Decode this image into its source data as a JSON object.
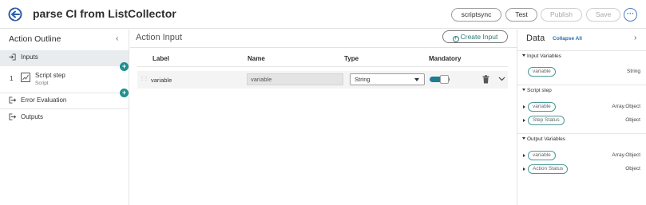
{
  "header": {
    "title": "parse CI from ListCollector",
    "buttons": {
      "scriptsync": "scriptsync",
      "test": "Test",
      "publish": "Publish",
      "save": "Save"
    },
    "more": "···"
  },
  "outline": {
    "title": "Action Outline",
    "collapse_glyph": "‹",
    "inputs": "Inputs",
    "step_number": "1",
    "script_step_title": "Script step",
    "script_step_sub": "Script",
    "error_evaluation": "Error Evaluation",
    "outputs": "Outputs",
    "add_glyph": "+"
  },
  "action_input": {
    "title": "Action Input",
    "create_button": "Create Input",
    "columns": {
      "label": "Label",
      "name": "Name",
      "type": "Type",
      "mandatory": "Mandatory"
    },
    "rows": [
      {
        "label": "variable",
        "name": "variable",
        "type": "String",
        "mandatory": true
      }
    ]
  },
  "data_panel": {
    "title": "Data",
    "collapse_all": "Collapse All",
    "expand_glyph": "›",
    "sections": [
      {
        "title": "Input Variables",
        "items": [
          {
            "pill": "variable",
            "type": "String"
          }
        ]
      },
      {
        "title": "Script step",
        "items": [
          {
            "pill": "variable",
            "type": "Array.Object"
          },
          {
            "pill": "Step Status",
            "type": "Object"
          }
        ]
      },
      {
        "title": "Output Variables",
        "items": [
          {
            "pill": "variable",
            "type": "Array.Object"
          },
          {
            "pill": "Action Status",
            "type": "Object"
          }
        ]
      }
    ]
  },
  "colors": {
    "accent_teal": "#1f8f8f",
    "toggle_on": "#1b7e92",
    "link_blue": "#2b6cb0",
    "selected_bg": "#e9ecef"
  }
}
